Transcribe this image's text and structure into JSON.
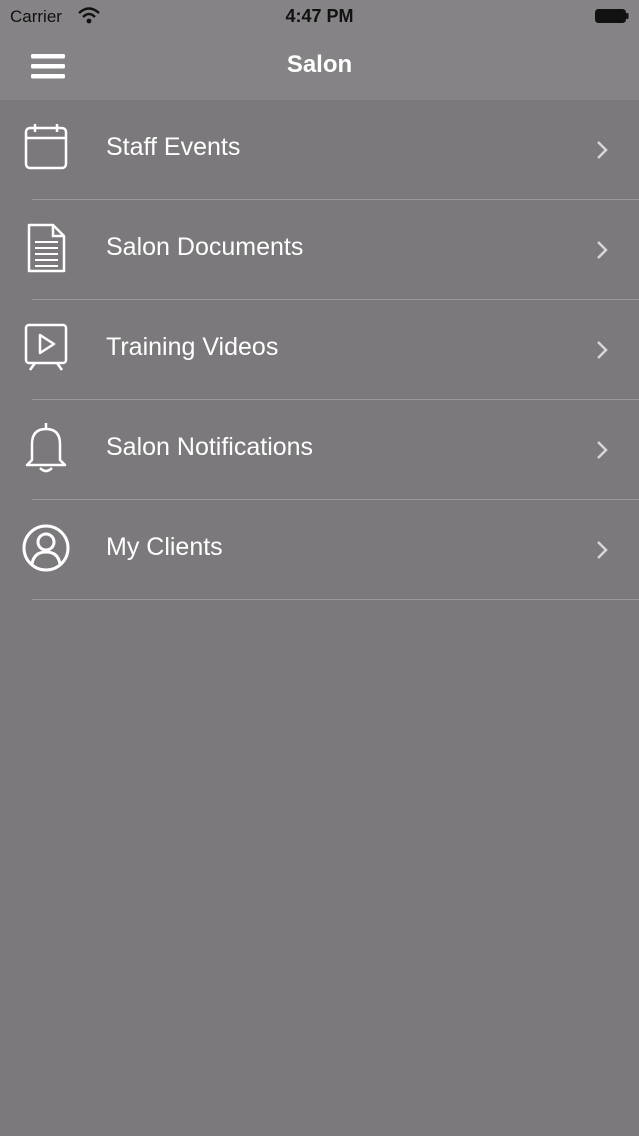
{
  "status_bar": {
    "carrier": "Carrier",
    "time": "4:47 PM",
    "wifi_icon": "wifi-icon",
    "battery_icon": "battery-icon"
  },
  "nav": {
    "title": "Salon",
    "menu_icon": "hamburger-menu-icon"
  },
  "menu_items": [
    {
      "label": "Staff Events",
      "icon": "calendar-icon"
    },
    {
      "label": "Salon Documents",
      "icon": "document-icon"
    },
    {
      "label": "Training Videos",
      "icon": "video-play-icon"
    },
    {
      "label": "Salon Notifications",
      "icon": "bell-icon"
    },
    {
      "label": "My Clients",
      "icon": "user-circle-icon"
    }
  ],
  "colors": {
    "background": "#7b797b",
    "nav_background": "#858385",
    "divider": "#9b999b",
    "text": "#ffffff"
  }
}
